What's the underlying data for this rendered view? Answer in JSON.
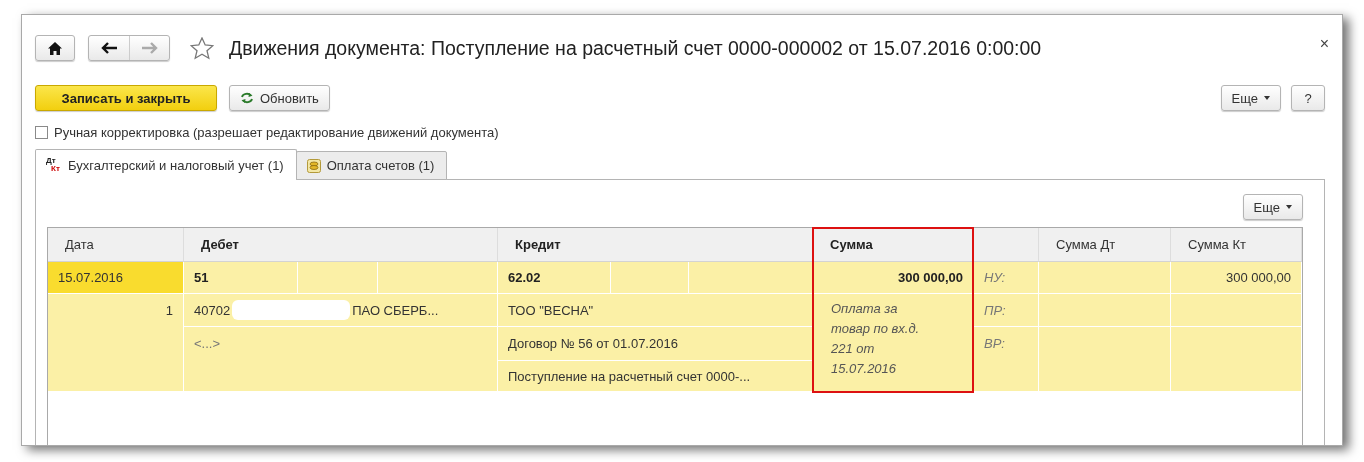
{
  "window": {
    "title": "Движения документа: Поступление на расчетный счет 0000-000002 от 15.07.2016 0:00:00",
    "close": "×"
  },
  "navigation": {
    "back": {
      "disabled": false
    },
    "forward": {
      "disabled": true
    },
    "favorite": {
      "on": false
    }
  },
  "toolbar": {
    "buttons": [
      {
        "label": "Записать и закрыть",
        "kind": "primary"
      },
      {
        "label": "Обновить",
        "kind": "refresh"
      }
    ],
    "more": "Еще",
    "help": "?"
  },
  "manual_correction": {
    "label": "Ручная корректировка (разрешает редактирование движений документа)",
    "checked": false
  },
  "tabs": [
    {
      "label": "Бухгалтерский и налоговый учет (1)",
      "selected": true,
      "kind": "dtkt",
      "icon_labels": [
        "Дт",
        "Кт"
      ]
    },
    {
      "label": "Оплата счетов (1)",
      "selected": false,
      "kind": "coins"
    }
  ],
  "table": {
    "more": "Еще",
    "columns": [
      {
        "label": "Дата"
      },
      {
        "label": "Дебет"
      },
      {
        "label": "Кредит"
      },
      {
        "label": "Сумма",
        "highlighted": true
      },
      {},
      {
        "label": "Сумма Дт"
      },
      {
        "label": "Сумма Кт"
      }
    ],
    "rows": [
      {
        "selected": true,
        "date": "15.07.2016",
        "number": "1",
        "debit": {
          "account": "51",
          "subconto": [
            "40702",
            "ПАО СБЕРБ..."
          ],
          "redacted": true,
          "more": "<...>"
        },
        "credit": {
          "account": "62.02",
          "subconto": [
            "ТОО \"ВЕСНА\"",
            "Договор № 56 от 01.07.2016",
            "Поступление на расчетный счет 0000-..."
          ]
        },
        "amount": "300 000,00",
        "content": "Оплата за товар по вх.д. 221 от 15.07.2016",
        "accounting_types": [
          "НУ:",
          "ПР:",
          "ВР:"
        ],
        "sum_kt": "300 000,00"
      }
    ]
  }
}
